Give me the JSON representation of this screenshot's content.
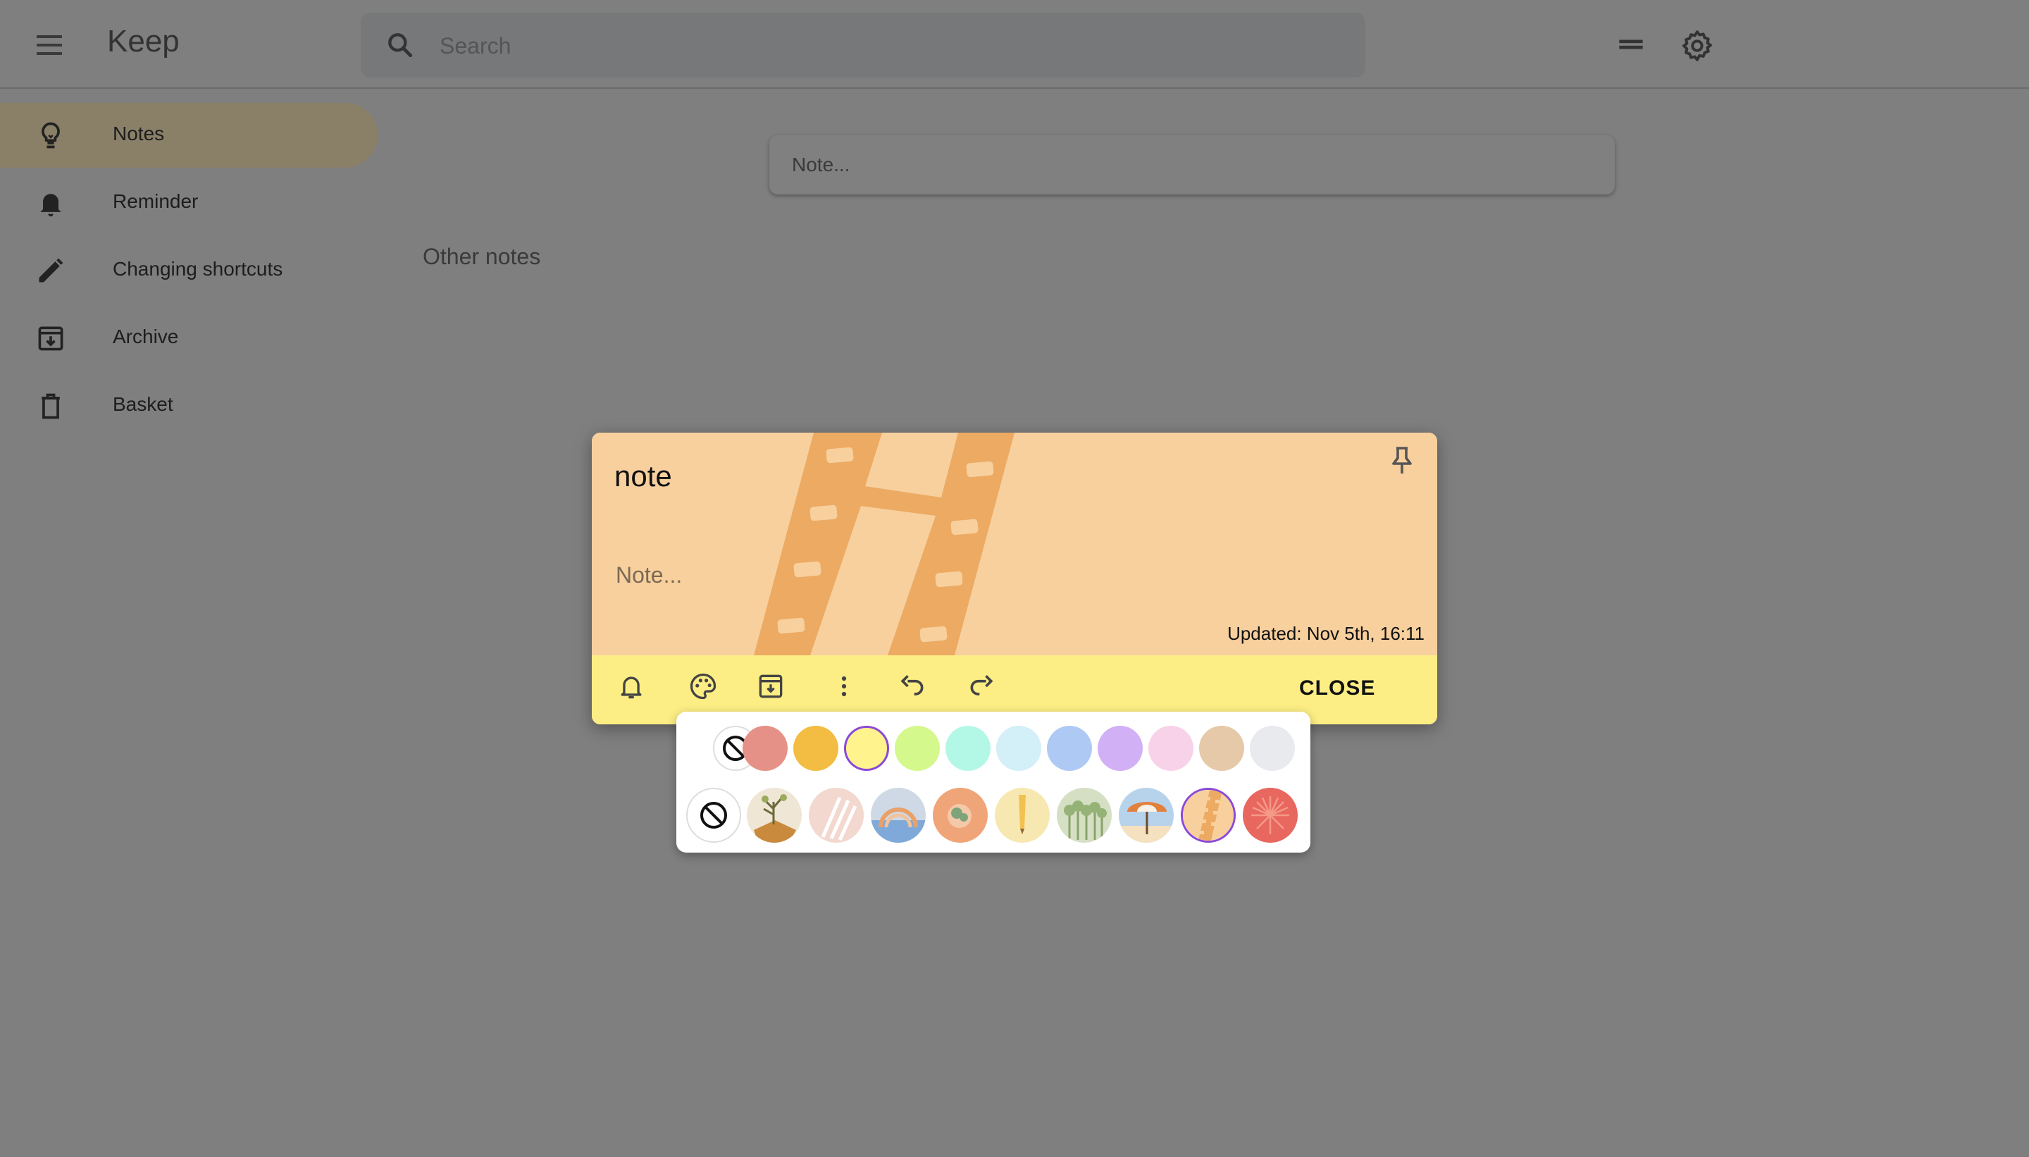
{
  "header": {
    "app_title": "Keep",
    "search_placeholder": "Search"
  },
  "sidebar": {
    "items": [
      {
        "label": "Notes",
        "icon": "lightbulb-icon",
        "active": true
      },
      {
        "label": "Reminder",
        "icon": "bell-icon",
        "active": false
      },
      {
        "label": "Changing shortcuts",
        "icon": "pencil-icon",
        "active": false
      },
      {
        "label": "Archive",
        "icon": "archive-icon",
        "active": false
      },
      {
        "label": "Basket",
        "icon": "trash-icon",
        "active": false
      }
    ]
  },
  "main": {
    "take_note_placeholder": "Note...",
    "section_title": "Other notes"
  },
  "modal": {
    "title": "note",
    "body_placeholder": "Note...",
    "updated": "Updated: Nov 5th, 16:11",
    "close_label": "CLOSE",
    "toolbar_icons": [
      "bell-icon",
      "palette-icon",
      "archive-icon",
      "more-vert-icon",
      "undo-icon",
      "redo-icon"
    ]
  },
  "palette": {
    "colors": [
      {
        "name": "default",
        "hex": "none"
      },
      {
        "name": "red",
        "hex": "#e69187"
      },
      {
        "name": "orange",
        "hex": "#f2bd42"
      },
      {
        "name": "yellow",
        "hex": "#fff38e",
        "selected": true
      },
      {
        "name": "green",
        "hex": "#d4f88c"
      },
      {
        "name": "teal",
        "hex": "#b3f7e6"
      },
      {
        "name": "blue",
        "hex": "#d3eff7"
      },
      {
        "name": "dark-blue",
        "hex": "#afc9f5"
      },
      {
        "name": "purple",
        "hex": "#d2b0f6"
      },
      {
        "name": "pink",
        "hex": "#f7d2e8"
      },
      {
        "name": "brown",
        "hex": "#e6c9a8"
      },
      {
        "name": "gray",
        "hex": "#e9eaee"
      }
    ],
    "backgrounds": [
      {
        "name": "none"
      },
      {
        "name": "groceries"
      },
      {
        "name": "food"
      },
      {
        "name": "music"
      },
      {
        "name": "recipes"
      },
      {
        "name": "notes"
      },
      {
        "name": "places"
      },
      {
        "name": "travel"
      },
      {
        "name": "video",
        "selected": true
      },
      {
        "name": "celebration"
      }
    ]
  }
}
